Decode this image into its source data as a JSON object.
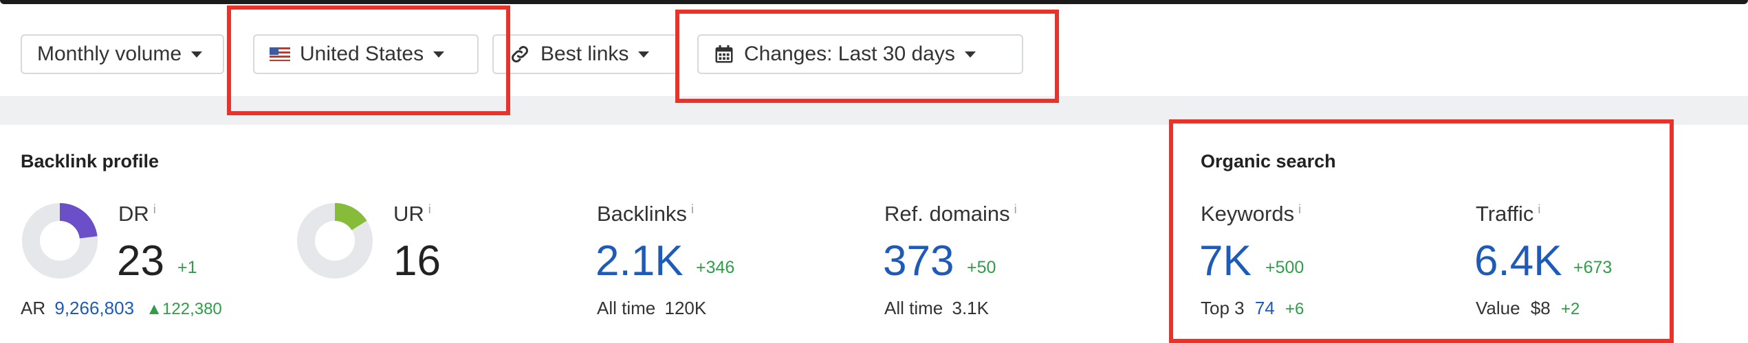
{
  "toolbar": {
    "volume_label": "Monthly volume",
    "country_label": "United States",
    "links_label": "Best links",
    "changes_label": "Changes: Last 30 days"
  },
  "backlink_profile": {
    "title": "Backlink profile",
    "dr": {
      "label": "DR",
      "info": "i",
      "value": "23",
      "delta": "+1",
      "fill_fraction": 0.23,
      "color": "#6b4fc9"
    },
    "ur": {
      "label": "UR",
      "info": "i",
      "value": "16",
      "fill_fraction": 0.16,
      "color": "#86bc3a"
    },
    "ar": {
      "label": "AR",
      "value": "9,266,803",
      "delta": "▲122,380"
    },
    "backlinks": {
      "label": "Backlinks",
      "info": "i",
      "value": "2.1K",
      "delta": "+346",
      "all_time_label": "All time",
      "all_time_value": "120K"
    },
    "ref_domains": {
      "label": "Ref. domains",
      "info": "i",
      "value": "373",
      "delta": "+50",
      "all_time_label": "All time",
      "all_time_value": "3.1K"
    }
  },
  "organic_search": {
    "title": "Organic search",
    "keywords": {
      "label": "Keywords",
      "info": "i",
      "value": "7K",
      "delta": "+500",
      "top3_label": "Top 3",
      "top3_value": "74",
      "top3_delta": "+6"
    },
    "traffic": {
      "label": "Traffic",
      "info": "i",
      "value": "6.4K",
      "delta": "+673",
      "value_label": "Value",
      "value_amount": "$8",
      "value_delta": "+2"
    }
  },
  "colors": {
    "highlight": "#e5342b",
    "link_blue": "#1e5bb8",
    "positive_green": "#2e9e48",
    "band": "#eef0f2"
  },
  "icons": [
    "caret-down-icon",
    "us-flag-icon",
    "link-icon",
    "calendar-icon",
    "info-icon"
  ]
}
